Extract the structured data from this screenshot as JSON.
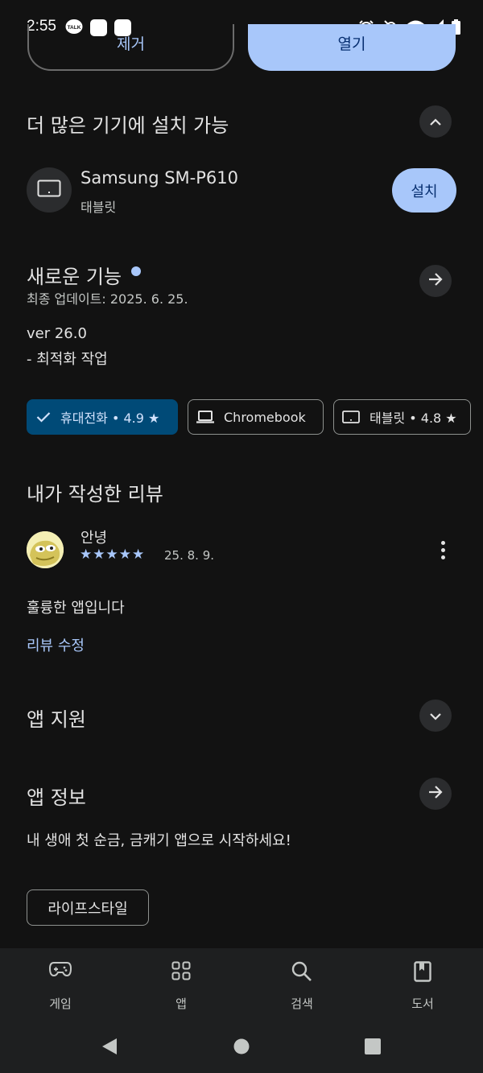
{
  "status_bar": {
    "time": "2:55",
    "talk_badge": "TALK"
  },
  "top_buttons": {
    "left_label": "제거",
    "right_label": "열기"
  },
  "install_section": {
    "title": "더 많은 기기에 설치 가능",
    "device_name": "Samsung SM-P610",
    "device_type": "태블릿",
    "install_label": "설치"
  },
  "whats_new": {
    "title": "새로운 기능",
    "last_updated": "최종 업데이트: 2025. 6. 25.",
    "version": "ver 26.0",
    "notes": "- 최적화 작업"
  },
  "device_chips": [
    {
      "label": "휴대전화 • 4.9 ★",
      "selected": true
    },
    {
      "label": "Chromebook",
      "selected": false
    },
    {
      "label": "태블릿 • 4.8 ★",
      "selected": false
    }
  ],
  "my_review": {
    "title": "내가 작성한 리뷰",
    "reviewer": "안녕",
    "stars": "★★★★★",
    "rating": 5,
    "date": "25. 8. 9.",
    "text": "훌륭한 앱입니다",
    "edit_label": "리뷰 수정"
  },
  "app_support": {
    "title": "앱 지원"
  },
  "app_info": {
    "title": "앱 정보",
    "description": "내 생애 첫 순금, 금캐기 앱으로 시작하세요!",
    "category": "라이프스타일"
  },
  "bottom_nav": [
    {
      "label": "게임",
      "icon": "gamepad-icon"
    },
    {
      "label": "앱",
      "icon": "apps-grid-icon"
    },
    {
      "label": "검색",
      "icon": "search-icon"
    },
    {
      "label": "도서",
      "icon": "book-icon"
    }
  ],
  "colors": {
    "accent": "#a8c7fa",
    "selected_chip": "#004a77",
    "background": "#121212"
  }
}
